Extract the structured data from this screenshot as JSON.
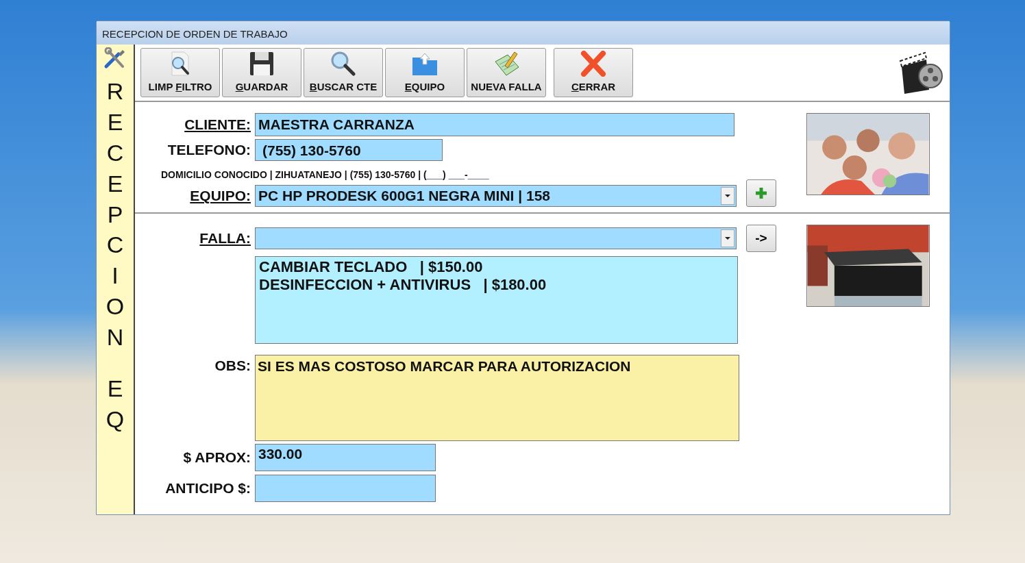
{
  "window": {
    "title": "RECEPCION DE ORDEN DE TRABAJO"
  },
  "side_title": [
    "RECEPCION",
    "EQ"
  ],
  "toolbar": [
    {
      "kind": "filter",
      "pre": "LIMP ",
      "key": "F",
      "post": "ILTRO"
    },
    {
      "kind": "save",
      "key": "G",
      "post": "UARDAR"
    },
    {
      "kind": "search",
      "key": "B",
      "post": "USCAR CTE"
    },
    {
      "kind": "folder",
      "key": "E",
      "post": "QUIPO"
    },
    {
      "kind": "notepad",
      "pre": "NUEVA FALLA"
    },
    {
      "kind": "close",
      "key": "C",
      "post": "ERRAR"
    }
  ],
  "cliente": {
    "label": "CLIENTE:",
    "underlined": true,
    "value": "MAESTRA CARRANZA"
  },
  "telefono": {
    "label": "TELEFONO:",
    "underlined": false,
    "value": "(755) 130-5760"
  },
  "address": "DOMICILIO CONOCIDO | ZIHUATANEJO | (755) 130-5760 | (___) ___-____",
  "equipo": {
    "label": "EQUIPO:",
    "underlined": true,
    "value": "PC HP PRODESK 600G1 NEGRA MINI  |  158"
  },
  "falla": {
    "label": "FALLA:",
    "underlined": true,
    "button": "->"
  },
  "fallas_list": [
    "CAMBIAR TECLADO   | $150.00",
    "DESINFECCION + ANTIVIRUS   | $180.00"
  ],
  "obs": {
    "label": "OBS:",
    "underlined": false,
    "value": "SI ES MAS COSTOSO MARCAR PARA AUTORIZACION"
  },
  "aprox": {
    "label": "$ APROX:",
    "underlined": false,
    "value": "330.00"
  },
  "anticipo": {
    "label": "ANTICIPO $:",
    "underlined": false
  }
}
